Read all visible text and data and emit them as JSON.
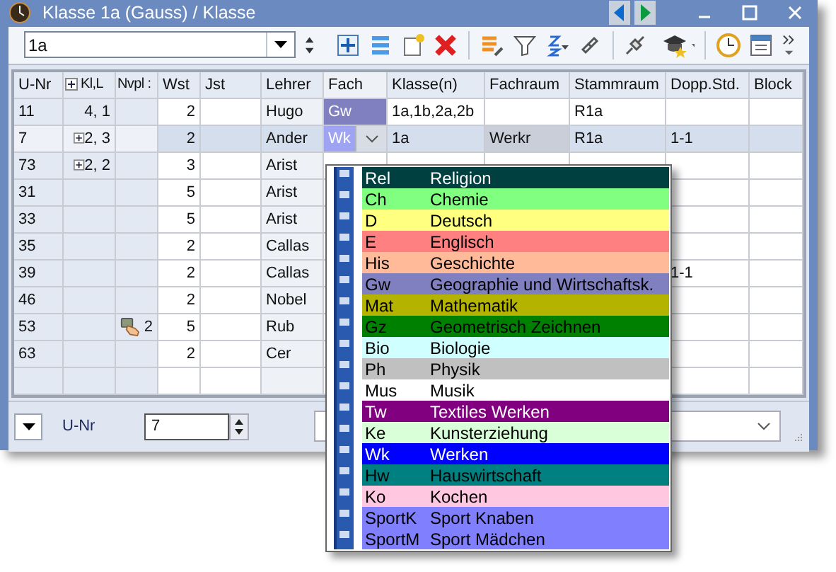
{
  "window": {
    "title": "Klasse 1a (Gauss) / Klasse"
  },
  "class_selector": {
    "value": "1a"
  },
  "table": {
    "columns": [
      "U-Nr",
      "Kl,L",
      "Nvpl :",
      "Wst",
      "Jst",
      "Lehrer",
      "Fach",
      "Klasse(n)",
      "Fachraum",
      "Stammraum",
      "Dopp.Std.",
      "Block"
    ],
    "rows": [
      {
        "u_nr": "11",
        "kl_le": "4, 1",
        "expandable": false,
        "wst": "2",
        "lehrer": "Hugo",
        "fach": {
          "text": "Gw",
          "color": "#8080c0"
        },
        "klassen": "1a,1b,2a,2b",
        "stammraum": "R1a",
        "selected": false
      },
      {
        "u_nr": "7",
        "kl_le": "2, 3",
        "expandable": true,
        "wst": "2",
        "lehrer": "Ander",
        "fach": {
          "text": "Wk",
          "color": "#9ea4f2"
        },
        "klassen": "1a",
        "fachraum": "Werkr",
        "stammraum": "R1a",
        "dopp": "1-1",
        "selected": true
      },
      {
        "u_nr": "73",
        "kl_le": "2, 2",
        "expandable": true,
        "wst": "3",
        "lehrer": "Arist",
        "selected": false
      },
      {
        "u_nr": "31",
        "expandable": false,
        "wst": "5",
        "lehrer": "Arist",
        "selected": false
      },
      {
        "u_nr": "33",
        "expandable": false,
        "wst": "5",
        "lehrer": "Arist",
        "selected": false
      },
      {
        "u_nr": "35",
        "expandable": false,
        "wst": "2",
        "lehrer": "Callas",
        "selected": false
      },
      {
        "u_nr": "39",
        "expandable": false,
        "wst": "2",
        "lehrer": "Callas",
        "dopp": "1-1",
        "selected": false
      },
      {
        "u_nr": "46",
        "expandable": false,
        "wst": "2",
        "lehrer": "Nobel",
        "selected": false
      },
      {
        "u_nr": "53",
        "expandable": false,
        "nvpl": "2",
        "wst": "5",
        "lehrer": "Rub",
        "selected": false
      },
      {
        "u_nr": "63",
        "expandable": false,
        "wst": "2",
        "lehrer": "Cer",
        "selected": false
      }
    ]
  },
  "subject_list": [
    {
      "code": "Rel",
      "name": "Religion",
      "color": "#004040"
    },
    {
      "code": "Ch",
      "name": "Chemie",
      "color": "#80ff80"
    },
    {
      "code": "D",
      "name": "Deutsch",
      "color": "#ffff80"
    },
    {
      "code": "E",
      "name": "Englisch",
      "color": "#ff8080"
    },
    {
      "code": "His",
      "name": "Geschichte",
      "color": "#ffbb99"
    },
    {
      "code": "Gw",
      "name": "Geographie und Wirtschaftsk.",
      "color": "#8080c0"
    },
    {
      "code": "Mat",
      "name": "Mathematik",
      "color": "#b4b400"
    },
    {
      "code": "Gz",
      "name": "Geometrisch Zeichnen",
      "color": "#008000"
    },
    {
      "code": "Bio",
      "name": "Biologie",
      "color": "#d0ffff"
    },
    {
      "code": "Ph",
      "name": "Physik",
      "color": "#c0c0c0"
    },
    {
      "code": "Mus",
      "name": "Musik",
      "color": "#ffffff"
    },
    {
      "code": "Tw",
      "name": "Textiles Werken",
      "color": "#800080"
    },
    {
      "code": "Ke",
      "name": "Kunsterziehung",
      "color": "#d8ffd8"
    },
    {
      "code": "Wk",
      "name": "Werken",
      "color": "#0000ff"
    },
    {
      "code": "Hw",
      "name": "Hauswirtschaft",
      "color": "#008080"
    },
    {
      "code": "Ko",
      "name": "Kochen",
      "color": "#ffc8e0"
    },
    {
      "code": "SportK",
      "name": "Sport Knaben",
      "color": "#8080ff"
    },
    {
      "code": "SportM",
      "name": "Sport Mädchen",
      "color": "#8080ff"
    }
  ],
  "footer": {
    "label": "U-Nr",
    "value": "7"
  }
}
